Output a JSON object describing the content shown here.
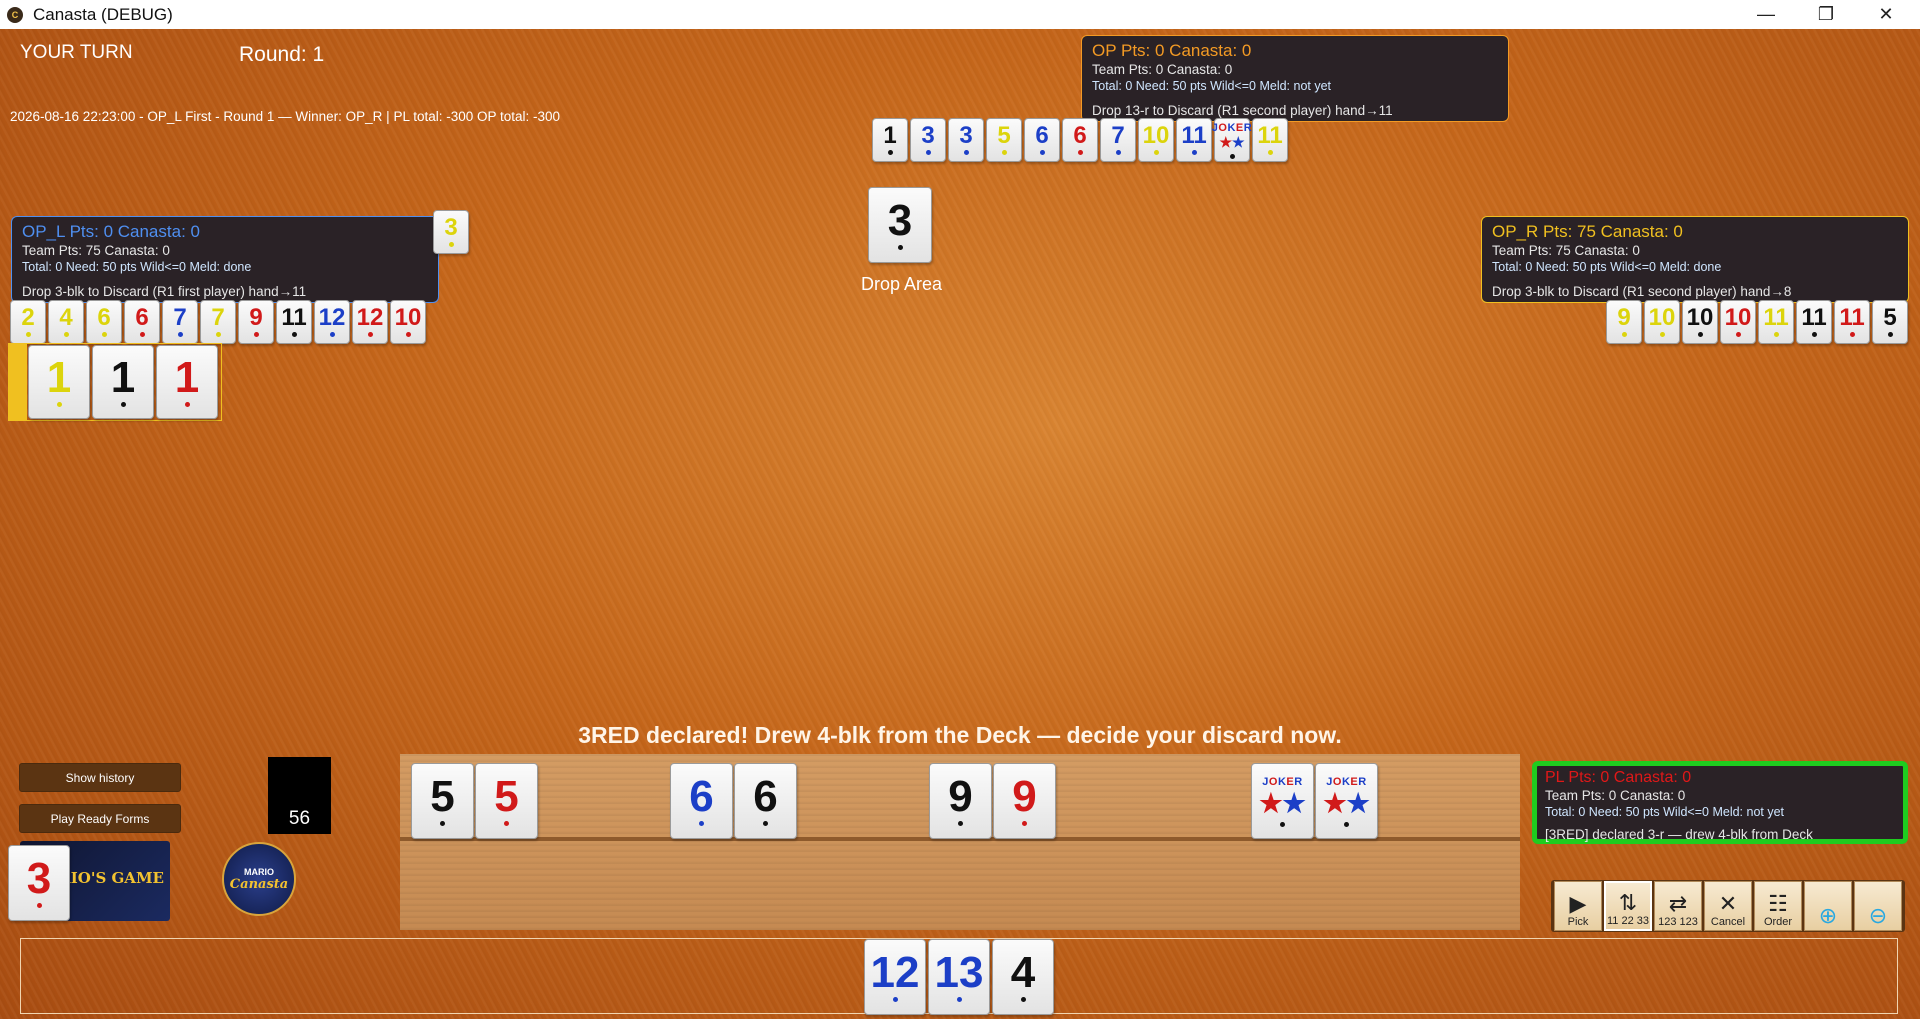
{
  "window": {
    "title": "Canasta (DEBUG)",
    "minimize": "—",
    "maximize": "❐",
    "close": "✕"
  },
  "status": {
    "turn": "YOUR TURN",
    "round": "Round: 1",
    "history_line": "2026-08-16 22:23:00 - OP_L First - Round 1  —  Winner: OP_R   |   PL total: -300   OP total: -300",
    "message": "3RED declared! Drew 4-blk from the Deck — decide your discard now."
  },
  "panels": {
    "op": {
      "title": "OP   Pts: 0   Canasta: 0",
      "team": "Team   Pts: 0   Canasta: 0",
      "stats": "Total: 0   Need: 50 pts   Wild<=0   Meld: not yet",
      "action": "Drop 13-r to Discard (R1 second player)  hand→11",
      "color": "#f39a24"
    },
    "op_l": {
      "title": "OP_L   Pts: 0   Canasta: 0",
      "team": "Team   Pts: 75   Canasta: 0",
      "stats": "Total: 0   Need: 50 pts   Wild<=0   Meld: done",
      "action": "Drop 3-blk to Discard (R1 first player)  hand→11",
      "color": "#4f8ff0"
    },
    "op_r": {
      "title": "OP_R   Pts: 75   Canasta: 0",
      "team": "Team   Pts: 75   Canasta: 0",
      "stats": "Total: 0   Need: 50 pts   Wild<=0   Meld: done",
      "action": "Drop 3-blk to Discard (R1 second player)  hand→8",
      "color": "#f0c020"
    },
    "pl": {
      "title": "PL   Pts: 0   Canasta: 0",
      "team": "Team   Pts: 0   Canasta: 0",
      "stats": "Total: 0   Need: 50 pts   Wild<=0   Meld: not yet",
      "action": "[3RED] declared 3-r — drew 4-blk from Deck",
      "color": "#e01818"
    }
  },
  "tiles": {
    "op_hand": [
      {
        "v": "1",
        "c": "black"
      },
      {
        "v": "3",
        "c": "blue"
      },
      {
        "v": "3",
        "c": "blue"
      },
      {
        "v": "5",
        "c": "yellow"
      },
      {
        "v": "6",
        "c": "blue"
      },
      {
        "v": "6",
        "c": "red"
      },
      {
        "v": "7",
        "c": "blue"
      },
      {
        "v": "10",
        "c": "yellow"
      },
      {
        "v": "11",
        "c": "blue"
      },
      {
        "v": "JOKER",
        "c": "joker"
      },
      {
        "v": "11",
        "c": "yellow"
      }
    ],
    "op_l_hand": [
      {
        "v": "2",
        "c": "yellow"
      },
      {
        "v": "4",
        "c": "yellow"
      },
      {
        "v": "6",
        "c": "yellow"
      },
      {
        "v": "6",
        "c": "red"
      },
      {
        "v": "7",
        "c": "blue"
      },
      {
        "v": "7",
        "c": "yellow"
      },
      {
        "v": "9",
        "c": "red"
      },
      {
        "v": "11",
        "c": "black"
      },
      {
        "v": "12",
        "c": "blue"
      },
      {
        "v": "12",
        "c": "red"
      },
      {
        "v": "10",
        "c": "red"
      }
    ],
    "op_l_extra": {
      "v": "3",
      "c": "yellow"
    },
    "op_l_meld": [
      {
        "v": "1",
        "c": "yellow"
      },
      {
        "v": "1",
        "c": "black"
      },
      {
        "v": "1",
        "c": "red"
      }
    ],
    "op_r_hand": [
      {
        "v": "9",
        "c": "yellow"
      },
      {
        "v": "10",
        "c": "yellow"
      },
      {
        "v": "10",
        "c": "black"
      },
      {
        "v": "10",
        "c": "red"
      },
      {
        "v": "11",
        "c": "yellow"
      },
      {
        "v": "11",
        "c": "black"
      },
      {
        "v": "11",
        "c": "red"
      },
      {
        "v": "5",
        "c": "black"
      }
    ],
    "discard": {
      "v": "3",
      "c": "black"
    },
    "discard_label": "Drop Area",
    "rack_top": [
      {
        "v": "5",
        "c": "black"
      },
      {
        "v": "5",
        "c": "red"
      },
      {
        "v": "6",
        "c": "blue"
      },
      {
        "v": "6",
        "c": "black"
      },
      {
        "v": "9",
        "c": "black"
      },
      {
        "v": "9",
        "c": "red"
      },
      {
        "v": "JOKER",
        "c": "joker"
      },
      {
        "v": "JOKER",
        "c": "joker"
      }
    ],
    "player_hand": [
      {
        "v": "12",
        "c": "blue"
      },
      {
        "v": "13",
        "c": "blue"
      },
      {
        "v": "4",
        "c": "black"
      }
    ],
    "red_three": {
      "v": "3",
      "c": "red"
    }
  },
  "deck": {
    "count": "56"
  },
  "buttons": {
    "show_history": "Show history",
    "play_ready_forms": "Play Ready Forms"
  },
  "logos": {
    "game": "MARIO'S GAME",
    "canasta_top": "MARIO",
    "canasta_bottom": "Canasta"
  },
  "toolbar": [
    {
      "label": "Pick",
      "icon": "▶",
      "name": "pick-button"
    },
    {
      "label": "11 22 33",
      "icon": "⇅",
      "name": "sort-pairs-button"
    },
    {
      "label": "123 123",
      "icon": "⇄",
      "name": "sort-runs-button"
    },
    {
      "label": "Cancel",
      "icon": "✕",
      "name": "cancel-button"
    },
    {
      "label": "Order",
      "icon": "☷",
      "name": "order-button"
    },
    {
      "label": "",
      "icon": "⊕",
      "name": "zoom-in-button"
    },
    {
      "label": "",
      "icon": "⊖",
      "name": "zoom-out-button"
    }
  ]
}
